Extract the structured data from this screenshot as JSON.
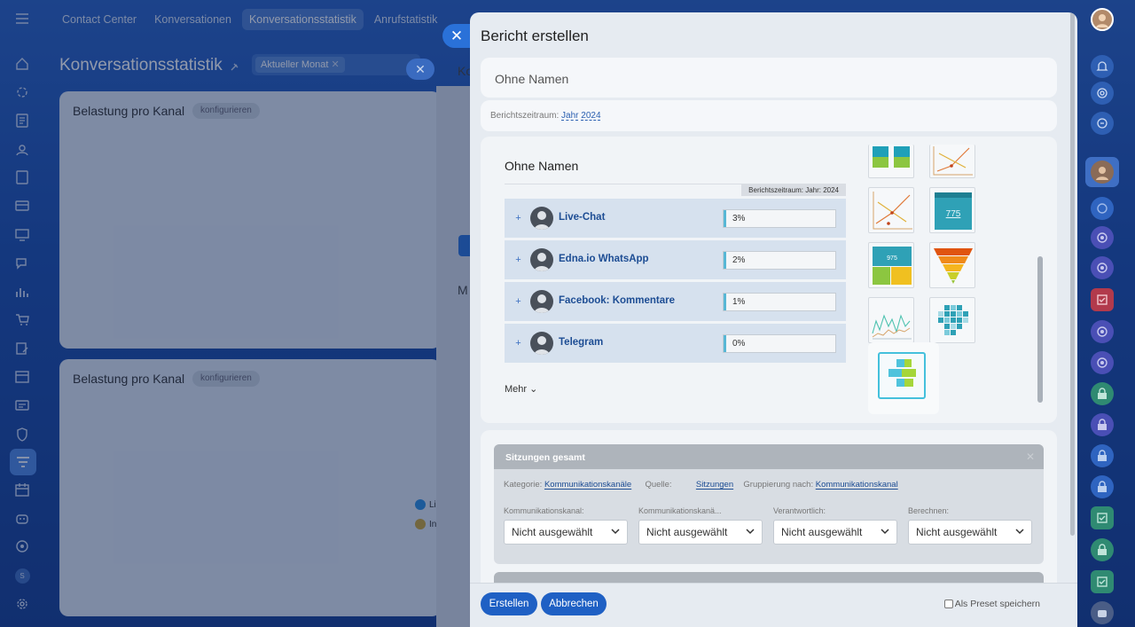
{
  "app": {
    "nav_tabs": [
      "Contact Center",
      "Konversationen",
      "Konversationsstatistik",
      "Anrufstatistik"
    ],
    "active_tab": "Konversationsstatistik",
    "page_title": "Konversationsstatistik",
    "filter_chip": "Aktueller Monat",
    "cards": [
      {
        "title": "Belastung pro Kanal",
        "button": "konfigurieren"
      },
      {
        "title": "Belastung pro Kanal",
        "button": "konfigurieren"
      }
    ],
    "bg_partial_letters": [
      "Ko",
      "M"
    ],
    "bg_legend": [
      "Li",
      "In"
    ],
    "left_rail_icons": [
      "menu-icon",
      "home-icon",
      "target-icon",
      "document-icon",
      "contacts-icon",
      "file-icon",
      "card-icon",
      "screen-icon",
      "chat-icon",
      "bar-chart-icon",
      "cart-icon",
      "edit-icon",
      "archive-icon",
      "id-card-icon",
      "shield-icon",
      "funnel-icon",
      "calendar-icon",
      "robot-icon",
      "goal-icon",
      "user-initial-icon",
      "settings-icon"
    ],
    "left_rail_initial": "S",
    "right_rail_icons": [
      "bell-icon",
      "at-icon",
      "search-chat-icon",
      "user-avatar-icon",
      "openline-icon",
      "openline-icon",
      "openline-icon",
      "checkbox-icon",
      "openline-icon",
      "openline-icon",
      "lock-icon",
      "lock-icon",
      "lock-icon",
      "lock-icon",
      "checkbox-icon",
      "lock-icon",
      "checkbox-icon",
      "bot-icon"
    ]
  },
  "modal": {
    "title": "Bericht erstellen",
    "name_placeholder": "Ohne Namen",
    "period_label": "Berichtszeitraum:",
    "period_unit": "Jahr",
    "period_year": "2024",
    "preview": {
      "title": "Ohne Namen",
      "period_tag": "Berichtszeitraum: Jahr: 2024",
      "rows": [
        {
          "name": "Live-Chat",
          "value": "3%"
        },
        {
          "name": "Edna.io WhatsApp",
          "value": "2%"
        },
        {
          "name": "Facebook: Kommentare",
          "value": "1%"
        },
        {
          "name": "Telegram",
          "value": "0%"
        }
      ],
      "more_label": "Mehr",
      "thumb_values": [
        "775",
        "975"
      ],
      "thumb_icons": [
        "bar-tiles-thumbnail-icon",
        "line-chart-thumbnail-icon",
        "line-chart-thumbnail-icon",
        "number-tile-thumbnail-icon",
        "tile-grid-thumbnail-icon",
        "funnel-thumbnail-icon",
        "area-line-thumbnail-icon",
        "heatmap-thumbnail-icon",
        "grouped-bars-thumbnail-icon"
      ]
    },
    "config": {
      "card_title": "Sitzungen gesamt",
      "kategorie_label": "Kategorie:",
      "kategorie_value": "Kommunikationskanäle",
      "quelle_label": "Quelle:",
      "quelle_value": "Sitzungen",
      "gruppierung_label": "Gruppierung nach:",
      "gruppierung_value": "Kommunikationskanal",
      "filters": [
        {
          "label": "Kommunikationskanal:",
          "value": "Nicht ausgewählt"
        },
        {
          "label": "Kommunikationskanä...",
          "value": "Nicht ausgewählt"
        },
        {
          "label": "Verantwortlich:",
          "value": "Nicht ausgewählt"
        },
        {
          "label": "Berechnen:",
          "value": "Nicht ausgewählt"
        }
      ]
    },
    "footer": {
      "create": "Erstellen",
      "cancel": "Abbrechen",
      "preset": "Als Preset speichern"
    }
  },
  "colors": {
    "accent": "#1f60c4",
    "link": "#2a5fb0",
    "bar_fill": "#57b7d5",
    "thumb_selected_border": "#44c0dc"
  }
}
